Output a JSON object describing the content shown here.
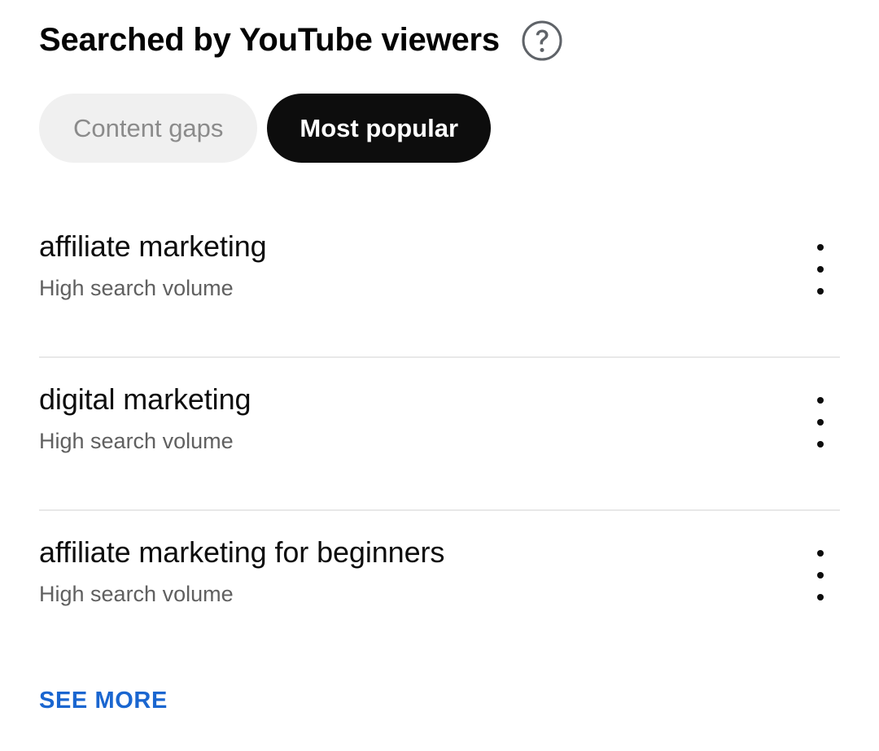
{
  "header": {
    "title": "Searched by YouTube viewers",
    "help_icon": "help-circle-icon"
  },
  "chips": [
    {
      "label": "Content gaps",
      "state": "inactive"
    },
    {
      "label": "Most popular",
      "state": "active"
    }
  ],
  "rows": [
    {
      "keyword": "affiliate marketing",
      "volume_label": "High search volume",
      "menu_icon": "more-vertical-icon"
    },
    {
      "keyword": "digital marketing",
      "volume_label": "High search volume",
      "menu_icon": "more-vertical-icon"
    },
    {
      "keyword": "affiliate marketing for beginners",
      "volume_label": "High search volume",
      "menu_icon": "more-vertical-icon"
    }
  ],
  "footer": {
    "see_more_label": "SEE MORE"
  },
  "colors": {
    "background": "#ffffff",
    "text_primary": "#0d0d0d",
    "text_secondary": "#606060",
    "chip_active_bg": "#0d0d0d",
    "chip_active_text": "#ffffff",
    "chip_inactive_bg": "#f0f0f0",
    "chip_inactive_text": "#8b8b8b",
    "divider": "#e8e8e8",
    "link": "#1A66D0",
    "help_icon": "#5f6368"
  }
}
